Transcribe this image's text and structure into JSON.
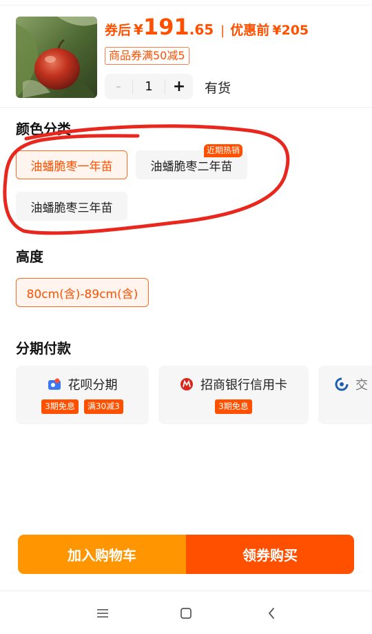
{
  "product": {
    "price_prefix": "券后",
    "currency": "¥",
    "price_int": "191",
    "price_dec": ".65",
    "separator": "|",
    "orig_label": "优惠前",
    "orig_price": "¥205",
    "coupon": "商品券满50减5",
    "stepper": {
      "minus": "-",
      "value": "1",
      "plus": "+"
    },
    "stock": "有货"
  },
  "color_section": {
    "title": "颜色分类",
    "options": [
      {
        "label": "油蟠脆枣一年苗",
        "selected": true
      },
      {
        "label": "油蟠脆枣二年苗",
        "selected": false,
        "badge": "近期热销"
      },
      {
        "label": "油蟠脆枣三年苗",
        "selected": false
      }
    ]
  },
  "height_section": {
    "title": "高度",
    "options": [
      {
        "label": "80cm(含)-89cm(含)",
        "selected": true
      }
    ]
  },
  "installment_section": {
    "title": "分期付款",
    "cards": [
      {
        "name": "花呗分期",
        "icon": "huabei-icon",
        "badges": [
          "3期免息",
          "满30减3"
        ]
      },
      {
        "name": "招商银行信用卡",
        "icon": "cmb-bank-icon",
        "badges": [
          "3期免息"
        ]
      },
      {
        "name": "交",
        "icon": "bank-icon",
        "badges": []
      }
    ]
  },
  "actions": {
    "add_to_cart": "加入购物车",
    "buy": "领券购买"
  },
  "colors": {
    "accent": "#ff5000",
    "cart_button": "#ff9500",
    "annotation_stroke": "#e8281e"
  }
}
